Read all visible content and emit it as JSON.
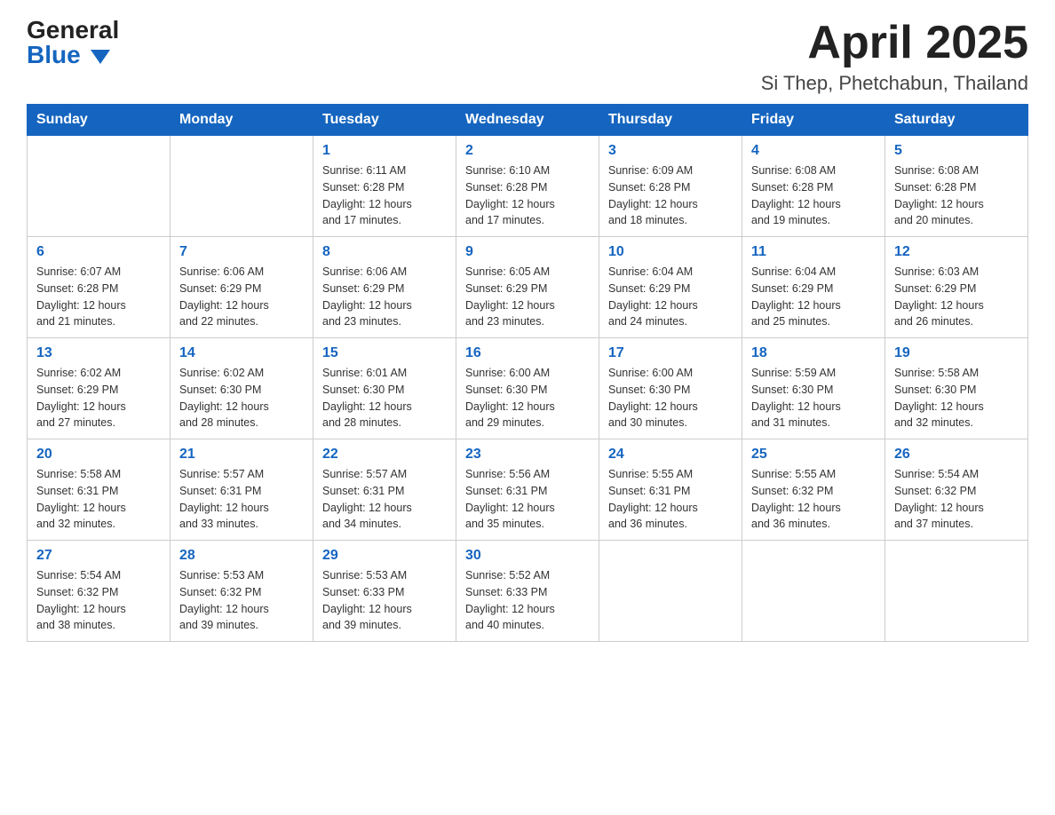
{
  "logo": {
    "general": "General",
    "blue": "Blue",
    "triangle": "▲"
  },
  "title": {
    "month_year": "April 2025",
    "location": "Si Thep, Phetchabun, Thailand"
  },
  "weekdays": [
    "Sunday",
    "Monday",
    "Tuesday",
    "Wednesday",
    "Thursday",
    "Friday",
    "Saturday"
  ],
  "weeks": [
    [
      {
        "day": "",
        "info": ""
      },
      {
        "day": "",
        "info": ""
      },
      {
        "day": "1",
        "info": "Sunrise: 6:11 AM\nSunset: 6:28 PM\nDaylight: 12 hours\nand 17 minutes."
      },
      {
        "day": "2",
        "info": "Sunrise: 6:10 AM\nSunset: 6:28 PM\nDaylight: 12 hours\nand 17 minutes."
      },
      {
        "day": "3",
        "info": "Sunrise: 6:09 AM\nSunset: 6:28 PM\nDaylight: 12 hours\nand 18 minutes."
      },
      {
        "day": "4",
        "info": "Sunrise: 6:08 AM\nSunset: 6:28 PM\nDaylight: 12 hours\nand 19 minutes."
      },
      {
        "day": "5",
        "info": "Sunrise: 6:08 AM\nSunset: 6:28 PM\nDaylight: 12 hours\nand 20 minutes."
      }
    ],
    [
      {
        "day": "6",
        "info": "Sunrise: 6:07 AM\nSunset: 6:28 PM\nDaylight: 12 hours\nand 21 minutes."
      },
      {
        "day": "7",
        "info": "Sunrise: 6:06 AM\nSunset: 6:29 PM\nDaylight: 12 hours\nand 22 minutes."
      },
      {
        "day": "8",
        "info": "Sunrise: 6:06 AM\nSunset: 6:29 PM\nDaylight: 12 hours\nand 23 minutes."
      },
      {
        "day": "9",
        "info": "Sunrise: 6:05 AM\nSunset: 6:29 PM\nDaylight: 12 hours\nand 23 minutes."
      },
      {
        "day": "10",
        "info": "Sunrise: 6:04 AM\nSunset: 6:29 PM\nDaylight: 12 hours\nand 24 minutes."
      },
      {
        "day": "11",
        "info": "Sunrise: 6:04 AM\nSunset: 6:29 PM\nDaylight: 12 hours\nand 25 minutes."
      },
      {
        "day": "12",
        "info": "Sunrise: 6:03 AM\nSunset: 6:29 PM\nDaylight: 12 hours\nand 26 minutes."
      }
    ],
    [
      {
        "day": "13",
        "info": "Sunrise: 6:02 AM\nSunset: 6:29 PM\nDaylight: 12 hours\nand 27 minutes."
      },
      {
        "day": "14",
        "info": "Sunrise: 6:02 AM\nSunset: 6:30 PM\nDaylight: 12 hours\nand 28 minutes."
      },
      {
        "day": "15",
        "info": "Sunrise: 6:01 AM\nSunset: 6:30 PM\nDaylight: 12 hours\nand 28 minutes."
      },
      {
        "day": "16",
        "info": "Sunrise: 6:00 AM\nSunset: 6:30 PM\nDaylight: 12 hours\nand 29 minutes."
      },
      {
        "day": "17",
        "info": "Sunrise: 6:00 AM\nSunset: 6:30 PM\nDaylight: 12 hours\nand 30 minutes."
      },
      {
        "day": "18",
        "info": "Sunrise: 5:59 AM\nSunset: 6:30 PM\nDaylight: 12 hours\nand 31 minutes."
      },
      {
        "day": "19",
        "info": "Sunrise: 5:58 AM\nSunset: 6:30 PM\nDaylight: 12 hours\nand 32 minutes."
      }
    ],
    [
      {
        "day": "20",
        "info": "Sunrise: 5:58 AM\nSunset: 6:31 PM\nDaylight: 12 hours\nand 32 minutes."
      },
      {
        "day": "21",
        "info": "Sunrise: 5:57 AM\nSunset: 6:31 PM\nDaylight: 12 hours\nand 33 minutes."
      },
      {
        "day": "22",
        "info": "Sunrise: 5:57 AM\nSunset: 6:31 PM\nDaylight: 12 hours\nand 34 minutes."
      },
      {
        "day": "23",
        "info": "Sunrise: 5:56 AM\nSunset: 6:31 PM\nDaylight: 12 hours\nand 35 minutes."
      },
      {
        "day": "24",
        "info": "Sunrise: 5:55 AM\nSunset: 6:31 PM\nDaylight: 12 hours\nand 36 minutes."
      },
      {
        "day": "25",
        "info": "Sunrise: 5:55 AM\nSunset: 6:32 PM\nDaylight: 12 hours\nand 36 minutes."
      },
      {
        "day": "26",
        "info": "Sunrise: 5:54 AM\nSunset: 6:32 PM\nDaylight: 12 hours\nand 37 minutes."
      }
    ],
    [
      {
        "day": "27",
        "info": "Sunrise: 5:54 AM\nSunset: 6:32 PM\nDaylight: 12 hours\nand 38 minutes."
      },
      {
        "day": "28",
        "info": "Sunrise: 5:53 AM\nSunset: 6:32 PM\nDaylight: 12 hours\nand 39 minutes."
      },
      {
        "day": "29",
        "info": "Sunrise: 5:53 AM\nSunset: 6:33 PM\nDaylight: 12 hours\nand 39 minutes."
      },
      {
        "day": "30",
        "info": "Sunrise: 5:52 AM\nSunset: 6:33 PM\nDaylight: 12 hours\nand 40 minutes."
      },
      {
        "day": "",
        "info": ""
      },
      {
        "day": "",
        "info": ""
      },
      {
        "day": "",
        "info": ""
      }
    ]
  ]
}
